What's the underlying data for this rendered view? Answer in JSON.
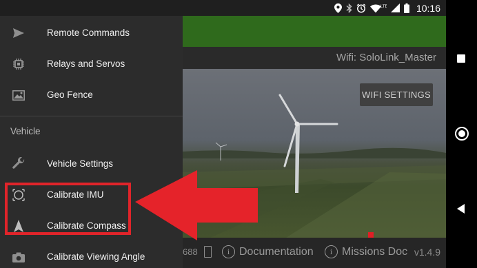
{
  "status_bar": {
    "time": "10:16",
    "icons": [
      "location-icon",
      "bluetooth-icon",
      "alarm-icon",
      "wifi-lte-icon",
      "signal-icon",
      "battery-icon"
    ]
  },
  "main": {
    "wifi_label": "Wifi: SoloLink_Master",
    "wifi_settings_button": "WIFI SETTINGS",
    "footer": {
      "partial_value": "688",
      "documentation_label": "Documentation",
      "missions_doc_label": "Missions Doc",
      "version": "v1.4.9"
    }
  },
  "drawer": {
    "items_top": [
      {
        "label": "Remote Commands",
        "icon": "send-icon"
      },
      {
        "label": "Relays and Servos",
        "icon": "chip-icon"
      },
      {
        "label": "Geo Fence",
        "icon": "map-icon"
      }
    ],
    "section_header": "Vehicle",
    "items_vehicle": [
      {
        "label": "Vehicle Settings",
        "icon": "wrench-icon"
      },
      {
        "label": "Calibrate IMU",
        "icon": "imu-icon"
      },
      {
        "label": "Calibrate Compass",
        "icon": "compass-icon"
      },
      {
        "label": "Calibrate Viewing Angle",
        "icon": "camera-icon"
      }
    ]
  },
  "annotation": {
    "highlight_color": "#e0242a"
  },
  "colors": {
    "green_bar": "#2f6a1c",
    "drawer_bg": "#2c2c2c"
  }
}
